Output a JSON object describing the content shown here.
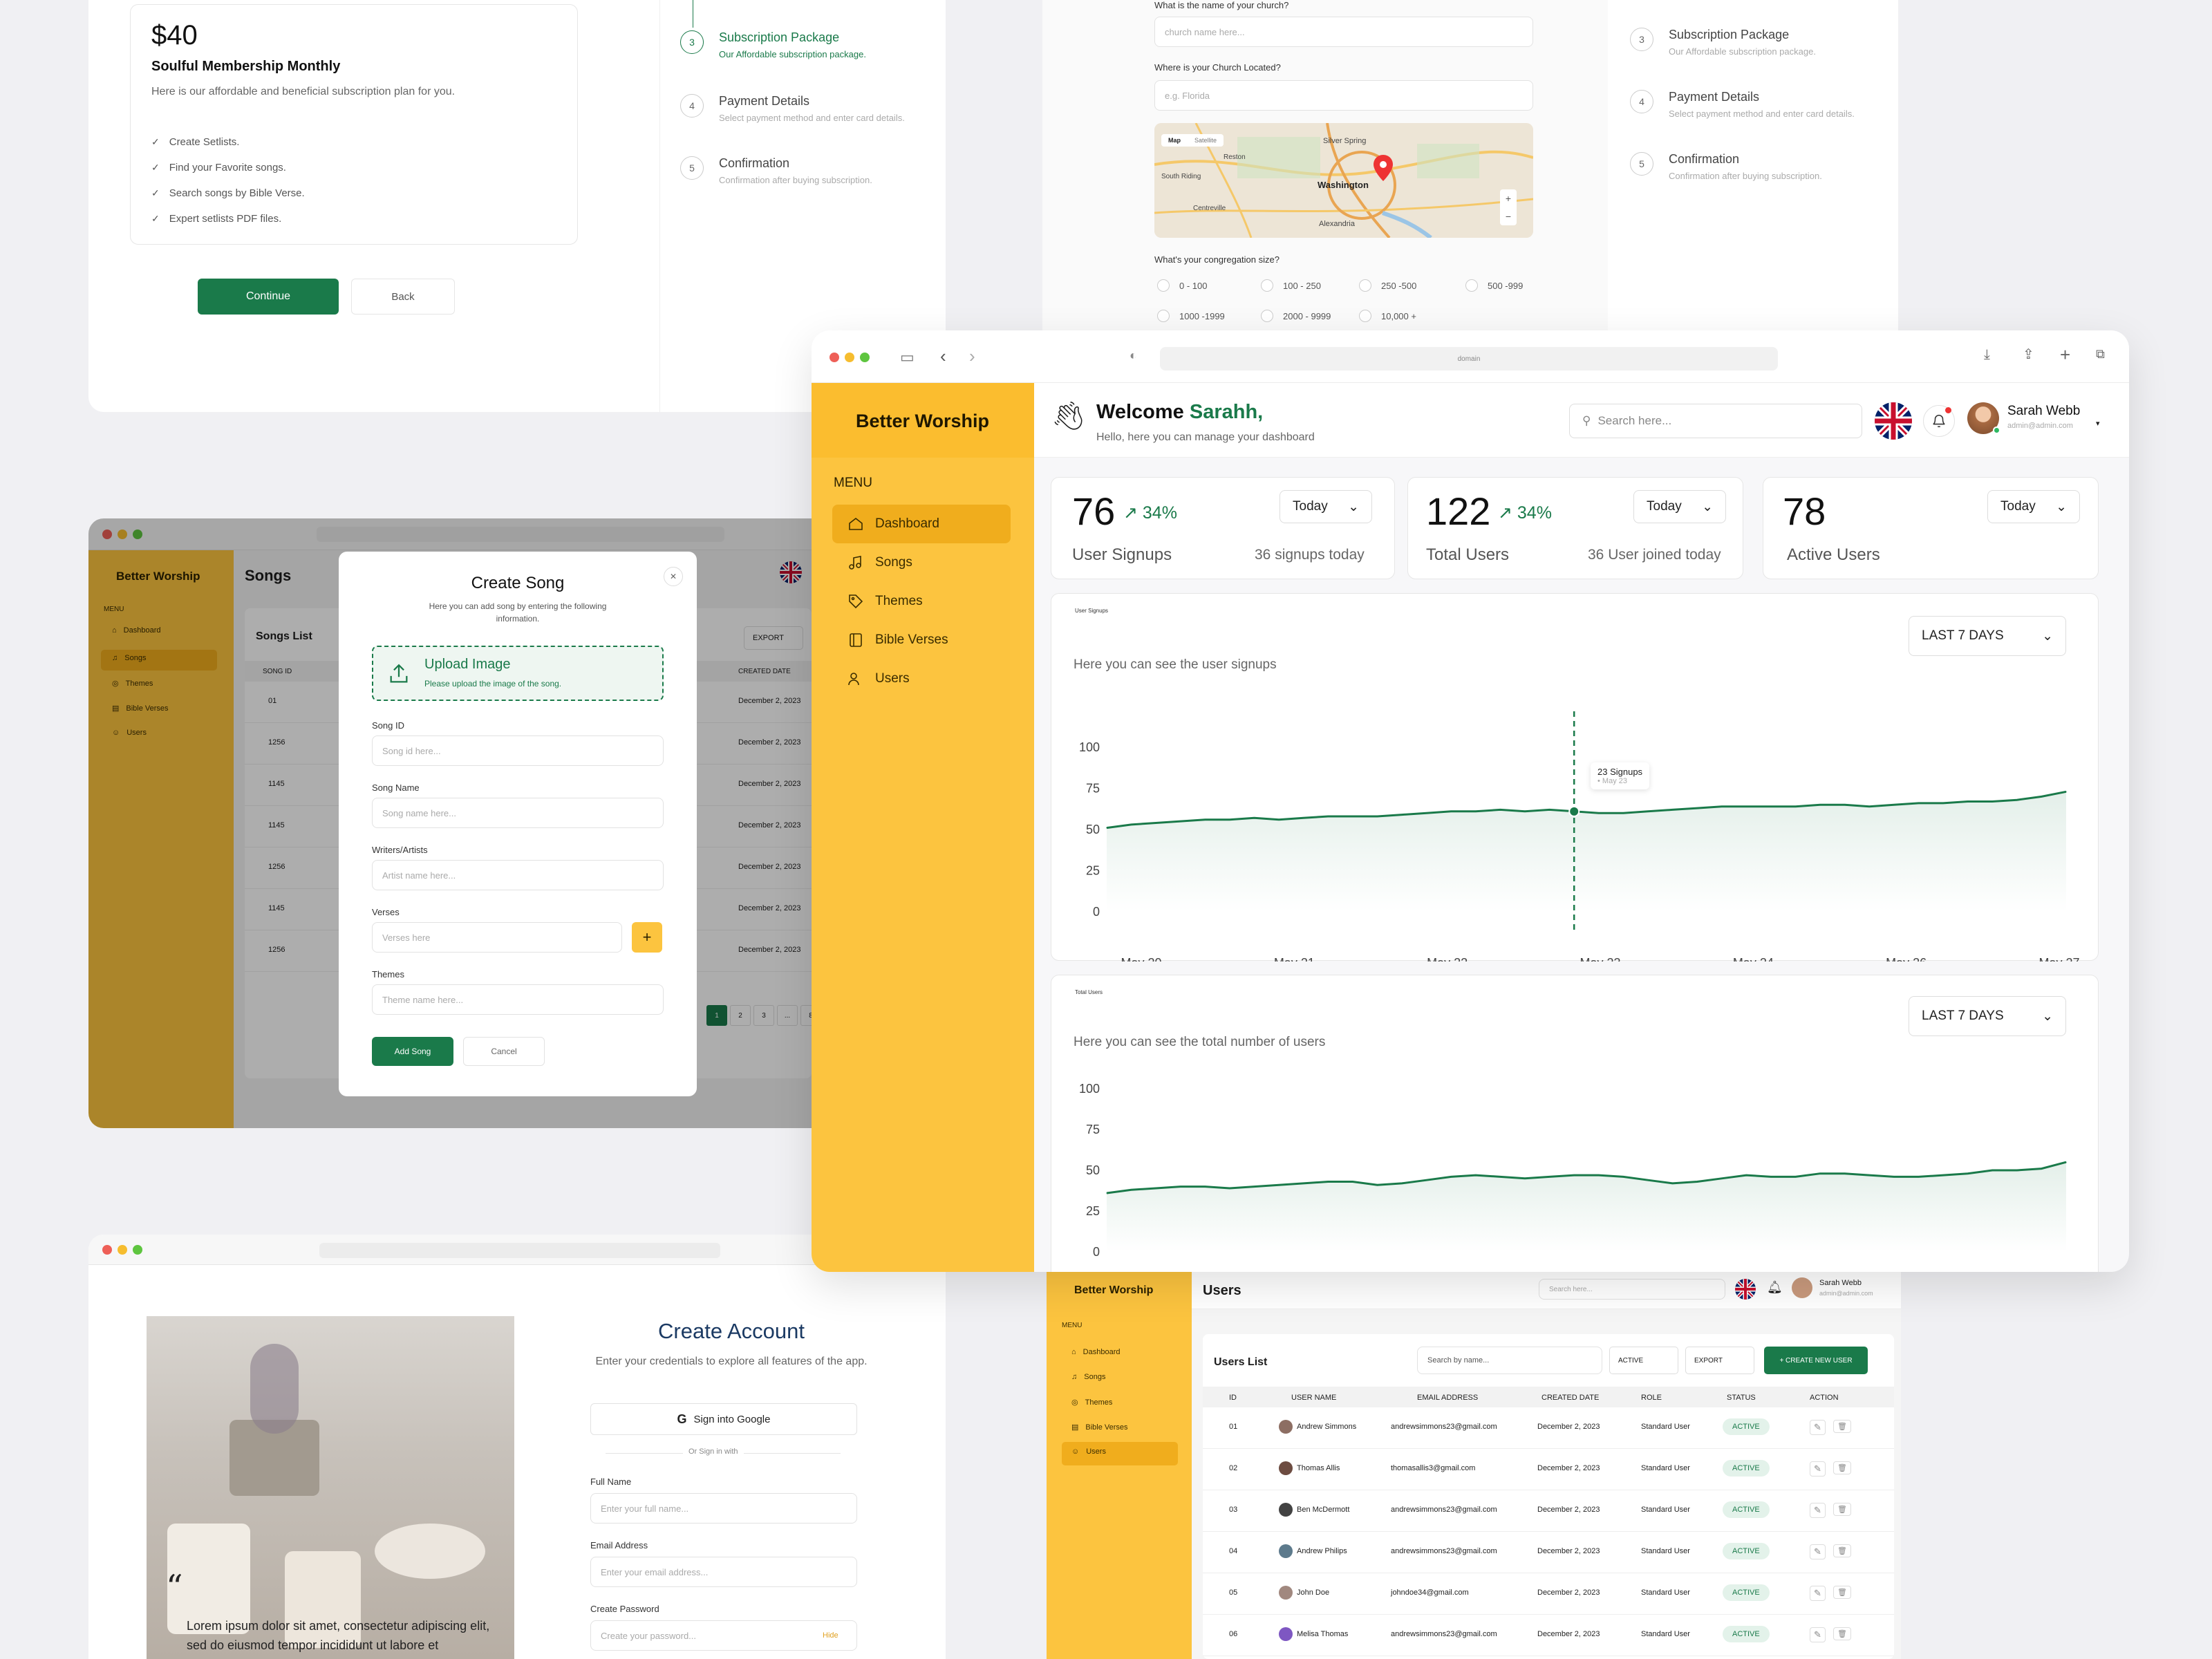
{
  "pricing": {
    "price": "$40",
    "plan_name": "Soulful Membership Monthly",
    "plan_desc": "Here is our affordable and beneficial subscription plan for you.",
    "features": [
      "Create Setlists.",
      "Find your Favorite songs.",
      "Search songs by Bible Verse.",
      "Expert setlists PDF files."
    ],
    "continue": "Continue",
    "back": "Back"
  },
  "steps": [
    {
      "num": "3",
      "title": "Subscription Package",
      "sub": "Our Affordable subscription package."
    },
    {
      "num": "4",
      "title": "Payment Details",
      "sub": "Select payment method and enter card details."
    },
    {
      "num": "5",
      "title": "Confirmation",
      "sub": "Confirmation after buying subscription."
    }
  ],
  "church": {
    "q_name": "What is the name of your church?",
    "ph_name": "church name here...",
    "q_loc": "Where is your Church Located?",
    "ph_loc": "e.g. Florida",
    "map_tabs": [
      "Map",
      "Satellite"
    ],
    "map_places": [
      "Silver Spring",
      "Reston",
      "Washington",
      "South Riding",
      "Centreville",
      "Alexandria"
    ],
    "q_size": "What's your congregation size?",
    "sizes": [
      "0 - 100",
      "100 - 250",
      "250 -500",
      "500 -999",
      "1000 -1999",
      "2000 - 9999",
      "10,000 +"
    ]
  },
  "songs": {
    "brand": "Better Worship",
    "title": "Songs",
    "menu": "MENU",
    "nav": [
      "Dashboard",
      "Songs",
      "Themes",
      "Bible Verses",
      "Users"
    ],
    "list_title": "Songs List",
    "export": "EXPORT",
    "col_id": "SONG ID",
    "col_created": "CREATED DATE",
    "ids": [
      "01",
      "1256",
      "1145",
      "1145",
      "1256",
      "1145",
      "1256"
    ],
    "date": "December 2, 2023",
    "pages": [
      "1",
      "2",
      "3",
      "...",
      "8"
    ]
  },
  "modal": {
    "title": "Create Song",
    "sub": "Here you can add song by entering the following information.",
    "upload": "Upload Image",
    "upload_sub": "Please upload the image of the song.",
    "song_id": "Song ID",
    "song_id_ph": "Song id here...",
    "song_name": "Song Name",
    "song_name_ph": "Song name here...",
    "writers": "Writers/Artists",
    "writers_ph": "Artist name here...",
    "verses": "Verses",
    "verses_ph": "Verses here",
    "themes": "Themes",
    "themes_ph": "Theme name here...",
    "add": "Add Song",
    "cancel": "Cancel"
  },
  "account": {
    "title": "Create Account",
    "sub": "Enter your credentials to explore all features of the app.",
    "google": "Sign into Google",
    "or": "Or Sign in with",
    "full": "Full Name",
    "full_ph": "Enter your full name...",
    "email": "Email Address",
    "email_ph": "Enter your email address...",
    "pass": "Create Password",
    "pass_ph": "Create your password...",
    "hide": "Hide",
    "quote": "Lorem ipsum dolor sit amet, consectetur adipiscing elit, sed do eiusmod tempor incididunt ut labore et"
  },
  "dash": {
    "brand": "Better Worship",
    "menu": "MENU",
    "nav": [
      "Dashboard",
      "Songs",
      "Themes",
      "Bible Verses",
      "Users"
    ],
    "url": "domain",
    "welcome": "Welcome",
    "name": "Sarahh,",
    "welcome_sub": "Hello, here you can manage your dashboard",
    "search_ph": "Search here...",
    "user_name": "Sarah Webb",
    "user_email": "admin@admin.com",
    "stats": [
      {
        "value": "76",
        "change": "34%",
        "label": "User Signups",
        "note": "36 signups today",
        "period": "Today"
      },
      {
        "value": "122",
        "change": "34%",
        "label": "Total Users",
        "note": "36 User joined today",
        "period": "Today"
      },
      {
        "value": "78",
        "label": "Active Users",
        "period": "Today"
      }
    ],
    "range": "LAST 7 DAYS",
    "c1_tag": "User Signups",
    "c1_sub": "Here you can see the user signups",
    "c2_tag": "Total Users",
    "c2_sub": "Here you can see the total number of users",
    "tooltip": "23 Signups",
    "tooltip_sub": "• May 23"
  },
  "chart_data": [
    {
      "type": "area",
      "title": "User Signups",
      "x": [
        "May 20",
        "May 21",
        "May 22",
        "May 23",
        "May 24",
        "May 26",
        "May 27"
      ],
      "ylim": [
        0,
        100
      ],
      "yticks": [
        "0",
        "25",
        "50",
        "75",
        "100"
      ],
      "values": [
        51,
        53,
        54,
        55,
        56,
        56,
        57,
        56,
        57,
        58,
        58,
        58,
        59,
        60,
        61,
        61,
        62,
        61,
        62,
        61,
        60,
        60,
        61,
        62,
        63,
        64,
        64,
        64,
        64,
        65,
        65,
        64,
        65,
        66,
        66,
        67,
        67,
        68,
        70,
        73
      ]
    },
    {
      "type": "area",
      "title": "Total Users",
      "x": [],
      "ylim": [
        0,
        100
      ],
      "yticks": [
        "0",
        "25",
        "50",
        "75",
        "100"
      ],
      "values": [
        36,
        38,
        39,
        40,
        40,
        39,
        40,
        41,
        42,
        43,
        43,
        41,
        42,
        44,
        46,
        47,
        46,
        45,
        46,
        47,
        47,
        46,
        44,
        42,
        43,
        45,
        47,
        46,
        46,
        48,
        48,
        47,
        46,
        46,
        47,
        48,
        50,
        50,
        51,
        55
      ]
    }
  ],
  "users": {
    "brand": "Better Worship",
    "title": "Users",
    "menu": "MENU",
    "nav": [
      "Dashboard",
      "Songs",
      "Themes",
      "Bible Verses",
      "Users"
    ],
    "search_ph": "Search here...",
    "user_name": "Sarah Webb",
    "user_email": "admin@admin.com",
    "list": "Users List",
    "search2": "Search by name...",
    "active": "ACTIVE",
    "export": "EXPORT",
    "create": "+ CREATE NEW USER",
    "cols": [
      "ID",
      "USER NAME",
      "EMAIL ADDRESS",
      "CREATED DATE",
      "ROLE",
      "STATUS",
      "ACTION"
    ],
    "rows": [
      {
        "id": "01",
        "name": "Andrew Simmons",
        "email": "andrewsimmons23@gmail.com"
      },
      {
        "id": "02",
        "name": "Thomas Allis",
        "email": "thomasallis3@gmail.com"
      },
      {
        "id": "03",
        "name": "Ben McDermott",
        "email": "andrewsimmons23@gmail.com"
      },
      {
        "id": "04",
        "name": "Andrew Philips",
        "email": "andrewsimmons23@gmail.com"
      },
      {
        "id": "05",
        "name": "John Doe",
        "email": "johndoe34@gmail.com"
      },
      {
        "id": "06",
        "name": "Melisa Thomas",
        "email": "andrewsimmons23@gmail.com"
      }
    ],
    "date": "December 2, 2023",
    "role": "Standard User",
    "status": "ACTIVE"
  }
}
